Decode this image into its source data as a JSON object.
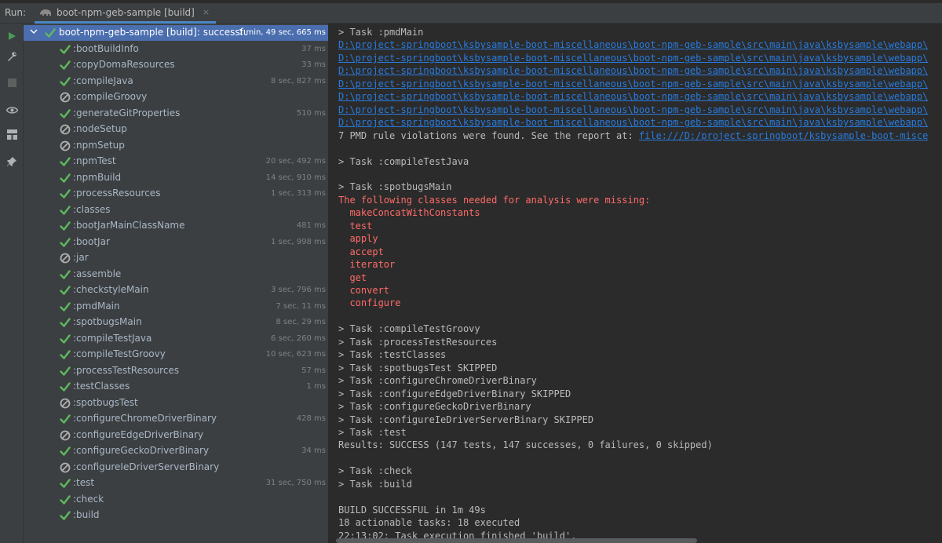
{
  "run_label": "Run:",
  "run_tab": {
    "title": "boot-npm-geb-sample [build]",
    "close": "×"
  },
  "tree": {
    "root": {
      "name": "boot-npm-geb-sample [build]: successful ⚠",
      "time": "1 min, 49 sec, 665 ms",
      "status": "success"
    },
    "tasks": [
      {
        "name": ":bootBuildInfo",
        "time": "37 ms",
        "status": "success"
      },
      {
        "name": ":copyDomaResources",
        "time": "33 ms",
        "status": "success"
      },
      {
        "name": ":compileJava",
        "time": "8 sec, 827 ms",
        "status": "success"
      },
      {
        "name": ":compileGroovy",
        "time": "",
        "status": "skipped"
      },
      {
        "name": ":generateGitProperties",
        "time": "510 ms",
        "status": "success"
      },
      {
        "name": ":nodeSetup",
        "time": "",
        "status": "skipped"
      },
      {
        "name": ":npmSetup",
        "time": "",
        "status": "skipped"
      },
      {
        "name": ":npmTest",
        "time": "20 sec, 492 ms",
        "status": "success"
      },
      {
        "name": ":npmBuild",
        "time": "14 sec, 910 ms",
        "status": "success"
      },
      {
        "name": ":processResources",
        "time": "1 sec, 313 ms",
        "status": "success"
      },
      {
        "name": ":classes",
        "time": "",
        "status": "success"
      },
      {
        "name": ":bootJarMainClassName",
        "time": "481 ms",
        "status": "success"
      },
      {
        "name": ":bootJar",
        "time": "1 sec, 998 ms",
        "status": "success"
      },
      {
        "name": ":jar",
        "time": "",
        "status": "skipped"
      },
      {
        "name": ":assemble",
        "time": "",
        "status": "success"
      },
      {
        "name": ":checkstyleMain",
        "time": "3 sec, 796 ms",
        "status": "success"
      },
      {
        "name": ":pmdMain",
        "time": "7 sec, 11 ms",
        "status": "success"
      },
      {
        "name": ":spotbugsMain",
        "time": "8 sec, 29 ms",
        "status": "success"
      },
      {
        "name": ":compileTestJava",
        "time": "6 sec, 260 ms",
        "status": "success"
      },
      {
        "name": ":compileTestGroovy",
        "time": "10 sec, 623 ms",
        "status": "success"
      },
      {
        "name": ":processTestResources",
        "time": "57 ms",
        "status": "success"
      },
      {
        "name": ":testClasses",
        "time": "1 ms",
        "status": "success"
      },
      {
        "name": ":spotbugsTest",
        "time": "",
        "status": "skipped"
      },
      {
        "name": ":configureChromeDriverBinary",
        "time": "428 ms",
        "status": "success"
      },
      {
        "name": ":configureEdgeDriverBinary",
        "time": "",
        "status": "skipped"
      },
      {
        "name": ":configureGeckoDriverBinary",
        "time": "34 ms",
        "status": "success"
      },
      {
        "name": ":configureIeDriverServerBinary",
        "time": "",
        "status": "skipped"
      },
      {
        "name": ":test",
        "time": "31 sec, 750 ms",
        "status": "success"
      },
      {
        "name": ":check",
        "time": "",
        "status": "success"
      },
      {
        "name": ":build",
        "time": "",
        "status": "success"
      }
    ]
  },
  "console": {
    "lines": [
      {
        "text": "> Task :pmdMain",
        "kind": "normal"
      },
      {
        "text": "D:\\project-springboot\\ksbysample-boot-miscellaneous\\boot-npm-geb-sample\\src\\main\\java\\ksbysample\\webapp\\",
        "kind": "link"
      },
      {
        "text": "D:\\project-springboot\\ksbysample-boot-miscellaneous\\boot-npm-geb-sample\\src\\main\\java\\ksbysample\\webapp\\",
        "kind": "link"
      },
      {
        "text": "D:\\project-springboot\\ksbysample-boot-miscellaneous\\boot-npm-geb-sample\\src\\main\\java\\ksbysample\\webapp\\",
        "kind": "link"
      },
      {
        "text": "D:\\project-springboot\\ksbysample-boot-miscellaneous\\boot-npm-geb-sample\\src\\main\\java\\ksbysample\\webapp\\",
        "kind": "link"
      },
      {
        "text": "D:\\project-springboot\\ksbysample-boot-miscellaneous\\boot-npm-geb-sample\\src\\main\\java\\ksbysample\\webapp\\",
        "kind": "link"
      },
      {
        "text": "D:\\project-springboot\\ksbysample-boot-miscellaneous\\boot-npm-geb-sample\\src\\main\\java\\ksbysample\\webapp\\",
        "kind": "link"
      },
      {
        "text": "D:\\project-springboot\\ksbysample-boot-miscellaneous\\boot-npm-geb-sample\\src\\main\\java\\ksbysample\\webapp\\",
        "kind": "link"
      },
      {
        "text": "7 PMD rule violations were found. See the report at: ",
        "kind": "mixed",
        "link": "file:///D:/project-springboot/ksbysample-boot-misce"
      },
      {
        "text": "",
        "kind": "normal"
      },
      {
        "text": "> Task :compileTestJava",
        "kind": "normal"
      },
      {
        "text": "",
        "kind": "normal"
      },
      {
        "text": "> Task :spotbugsMain",
        "kind": "normal"
      },
      {
        "text": "The following classes needed for analysis were missing:",
        "kind": "err"
      },
      {
        "text": "  makeConcatWithConstants",
        "kind": "err"
      },
      {
        "text": "  test",
        "kind": "err"
      },
      {
        "text": "  apply",
        "kind": "err"
      },
      {
        "text": "  accept",
        "kind": "err"
      },
      {
        "text": "  iterator",
        "kind": "err"
      },
      {
        "text": "  get",
        "kind": "err"
      },
      {
        "text": "  convert",
        "kind": "err"
      },
      {
        "text": "  configure",
        "kind": "err"
      },
      {
        "text": "",
        "kind": "normal"
      },
      {
        "text": "> Task :compileTestGroovy",
        "kind": "normal"
      },
      {
        "text": "> Task :processTestResources",
        "kind": "normal"
      },
      {
        "text": "> Task :testClasses",
        "kind": "normal"
      },
      {
        "text": "> Task :spotbugsTest SKIPPED",
        "kind": "normal"
      },
      {
        "text": "> Task :configureChromeDriverBinary",
        "kind": "normal"
      },
      {
        "text": "> Task :configureEdgeDriverBinary SKIPPED",
        "kind": "normal"
      },
      {
        "text": "> Task :configureGeckoDriverBinary",
        "kind": "normal"
      },
      {
        "text": "> Task :configureIeDriverServerBinary SKIPPED",
        "kind": "normal"
      },
      {
        "text": "> Task :test",
        "kind": "normal"
      },
      {
        "text": "Results: SUCCESS (147 tests, 147 successes, 0 failures, 0 skipped)",
        "kind": "normal"
      },
      {
        "text": "",
        "kind": "normal"
      },
      {
        "text": "> Task :check",
        "kind": "normal"
      },
      {
        "text": "> Task :build",
        "kind": "normal"
      },
      {
        "text": "",
        "kind": "normal"
      },
      {
        "text": "BUILD SUCCESSFUL in 1m 49s",
        "kind": "normal"
      },
      {
        "text": "18 actionable tasks: 18 executed",
        "kind": "normal"
      },
      {
        "text": "22:13:02: Task execution finished 'build'.",
        "kind": "normal"
      }
    ]
  },
  "colors": {
    "success": "#5fb85f",
    "skipped": "#b0b0b0",
    "selected": "#4b6eaf",
    "link": "#287bde",
    "error": "#ff6b68",
    "run_green": "#499c54"
  },
  "icons": [
    "run-icon",
    "wrench-icon",
    "stop-icon",
    "eye-icon",
    "layout-icon",
    "pin-icon",
    "gradle-elephant-icon",
    "check-icon",
    "skipped-icon",
    "chevron-down-icon"
  ]
}
